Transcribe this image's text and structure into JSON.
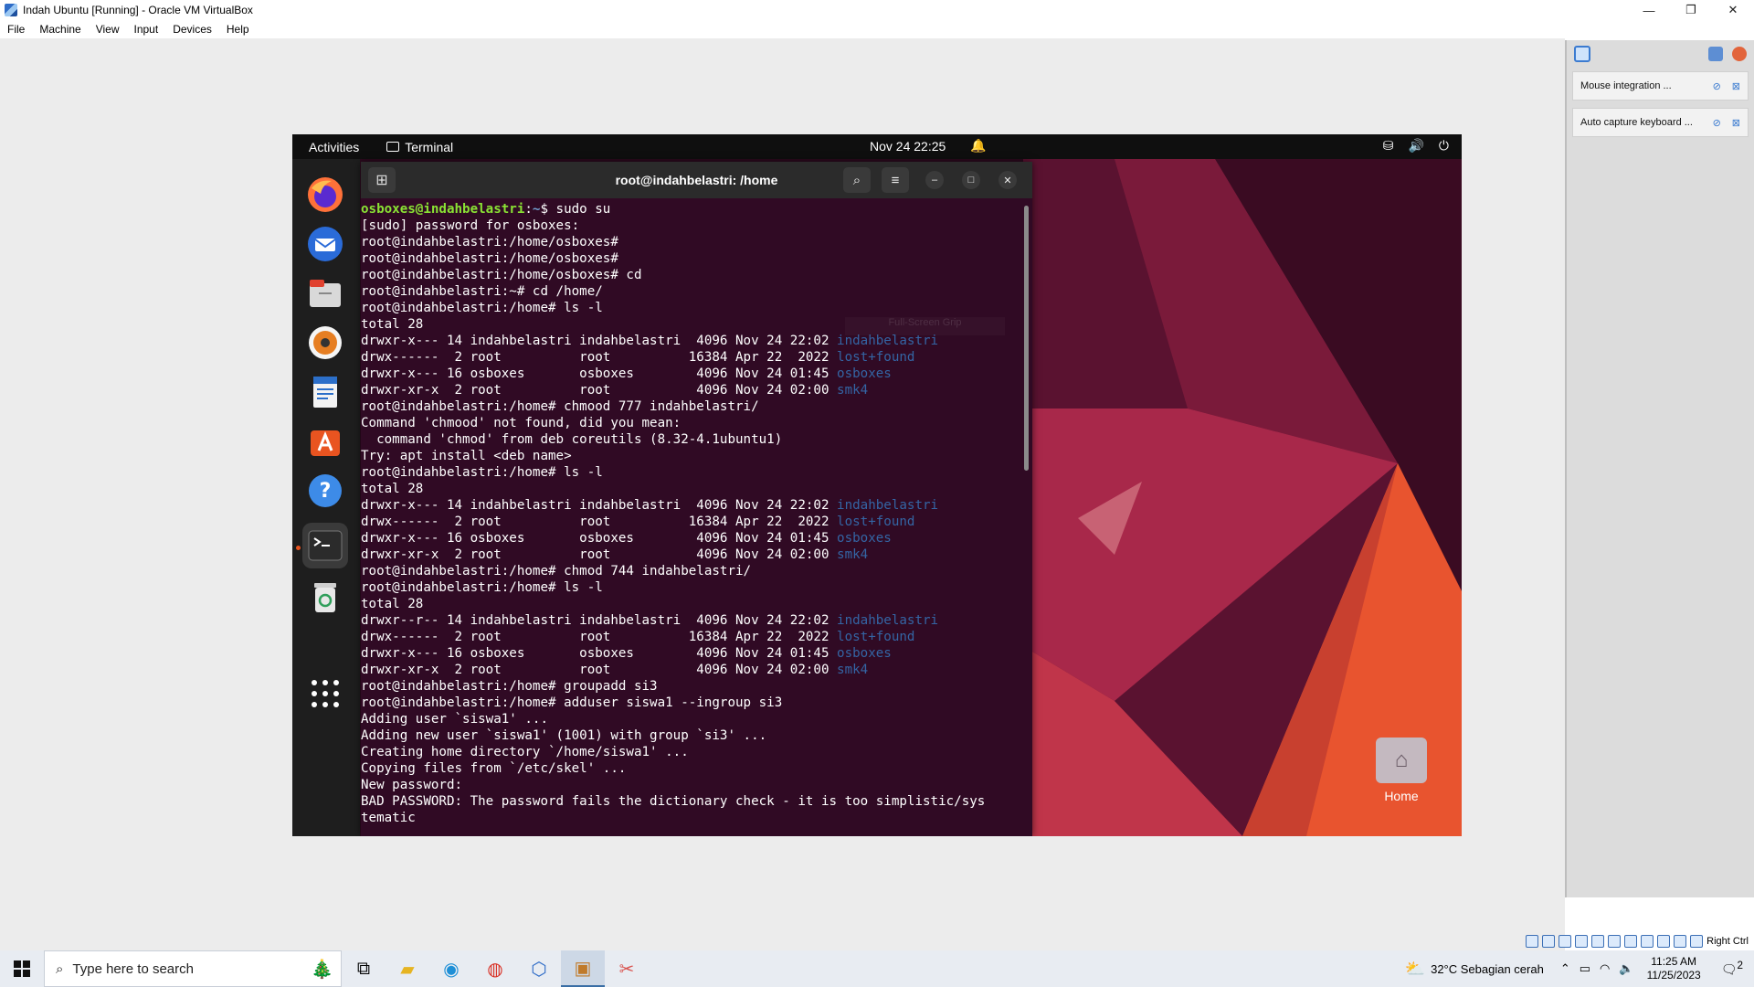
{
  "vbox": {
    "title": "Indah Ubuntu [Running] - Oracle VM VirtualBox",
    "menu": [
      "File",
      "Machine",
      "View",
      "Input",
      "Devices",
      "Help"
    ],
    "notifications": [
      {
        "text": "Mouse integration ..."
      },
      {
        "text": "Auto capture keyboard ..."
      }
    ],
    "host_key": "Right Ctrl"
  },
  "ubuntu": {
    "topbar": {
      "activities": "Activities",
      "app": "Terminal",
      "clock": "Nov 24  22:25"
    },
    "dock": [
      "firefox-icon",
      "thunderbird-icon",
      "files-icon",
      "rhythmbox-icon",
      "writer-icon",
      "app-center-icon",
      "help-icon",
      "terminal-icon",
      "trash-icon",
      "show-apps-icon"
    ],
    "terminal": {
      "title": "root@indahbelastri: /home",
      "ghost_tooltip": "Full-Screen Grip",
      "lines": [
        {
          "segments": [
            {
              "t": "osboxes@indahbelastri",
              "c": "u-green"
            },
            {
              "t": ":",
              "c": ""
            },
            {
              "t": "~",
              "c": "u-blue"
            },
            {
              "t": "$ sudo su",
              "c": ""
            }
          ]
        },
        {
          "segments": [
            {
              "t": "[sudo] password for osboxes:",
              "c": ""
            }
          ]
        },
        {
          "segments": [
            {
              "t": "root@indahbelastri:/home/osboxes#",
              "c": ""
            }
          ]
        },
        {
          "segments": [
            {
              "t": "root@indahbelastri:/home/osboxes#",
              "c": ""
            }
          ]
        },
        {
          "segments": [
            {
              "t": "root@indahbelastri:/home/osboxes# cd",
              "c": ""
            }
          ]
        },
        {
          "segments": [
            {
              "t": "root@indahbelastri:~# cd /home/",
              "c": ""
            }
          ]
        },
        {
          "segments": [
            {
              "t": "root@indahbelastri:/home# ls -l",
              "c": ""
            }
          ]
        },
        {
          "segments": [
            {
              "t": "total 28",
              "c": ""
            }
          ]
        },
        {
          "segments": [
            {
              "t": "drwxr-x--- 14 indahbelastri indahbelastri  4096 Nov 24 22:02 ",
              "c": ""
            },
            {
              "t": "indahbelastri",
              "c": "u-dir"
            }
          ]
        },
        {
          "segments": [
            {
              "t": "drwx------  2 root          root          16384 Apr 22  2022 ",
              "c": ""
            },
            {
              "t": "lost+found",
              "c": "u-dir"
            }
          ]
        },
        {
          "segments": [
            {
              "t": "drwxr-x--- 16 osboxes       osboxes        4096 Nov 24 01:45 ",
              "c": ""
            },
            {
              "t": "osboxes",
              "c": "u-dir"
            }
          ]
        },
        {
          "segments": [
            {
              "t": "drwxr-xr-x  2 root          root           4096 Nov 24 02:00 ",
              "c": ""
            },
            {
              "t": "smk4",
              "c": "u-dir"
            }
          ]
        },
        {
          "segments": [
            {
              "t": "root@indahbelastri:/home# chmood 777 indahbelastri/",
              "c": ""
            }
          ]
        },
        {
          "segments": [
            {
              "t": "Command 'chmood' not found, did you mean:",
              "c": ""
            }
          ]
        },
        {
          "segments": [
            {
              "t": "  command 'chmod' from deb coreutils (8.32-4.1ubuntu1)",
              "c": ""
            }
          ]
        },
        {
          "segments": [
            {
              "t": "Try: apt install <deb name>",
              "c": ""
            }
          ]
        },
        {
          "segments": [
            {
              "t": "root@indahbelastri:/home# ls -l",
              "c": ""
            }
          ]
        },
        {
          "segments": [
            {
              "t": "total 28",
              "c": ""
            }
          ]
        },
        {
          "segments": [
            {
              "t": "drwxr-x--- 14 indahbelastri indahbelastri  4096 Nov 24 22:02 ",
              "c": ""
            },
            {
              "t": "indahbelastri",
              "c": "u-dir"
            }
          ]
        },
        {
          "segments": [
            {
              "t": "drwx------  2 root          root          16384 Apr 22  2022 ",
              "c": ""
            },
            {
              "t": "lost+found",
              "c": "u-dir"
            }
          ]
        },
        {
          "segments": [
            {
              "t": "drwxr-x--- 16 osboxes       osboxes        4096 Nov 24 01:45 ",
              "c": ""
            },
            {
              "t": "osboxes",
              "c": "u-dir"
            }
          ]
        },
        {
          "segments": [
            {
              "t": "drwxr-xr-x  2 root          root           4096 Nov 24 02:00 ",
              "c": ""
            },
            {
              "t": "smk4",
              "c": "u-dir"
            }
          ]
        },
        {
          "segments": [
            {
              "t": "root@indahbelastri:/home# chmod 744 indahbelastri/",
              "c": ""
            }
          ]
        },
        {
          "segments": [
            {
              "t": "root@indahbelastri:/home# ls -l",
              "c": ""
            }
          ]
        },
        {
          "segments": [
            {
              "t": "total 28",
              "c": ""
            }
          ]
        },
        {
          "segments": [
            {
              "t": "drwxr--r-- 14 indahbelastri indahbelastri  4096 Nov 24 22:02 ",
              "c": ""
            },
            {
              "t": "indahbelastri",
              "c": "u-dir"
            }
          ]
        },
        {
          "segments": [
            {
              "t": "drwx------  2 root          root          16384 Apr 22  2022 ",
              "c": ""
            },
            {
              "t": "lost+found",
              "c": "u-dir"
            }
          ]
        },
        {
          "segments": [
            {
              "t": "drwxr-x--- 16 osboxes       osboxes        4096 Nov 24 01:45 ",
              "c": ""
            },
            {
              "t": "osboxes",
              "c": "u-dir"
            }
          ]
        },
        {
          "segments": [
            {
              "t": "drwxr-xr-x  2 root          root           4096 Nov 24 02:00 ",
              "c": ""
            },
            {
              "t": "smk4",
              "c": "u-dir"
            }
          ]
        },
        {
          "segments": [
            {
              "t": "root@indahbelastri:/home# groupadd si3",
              "c": ""
            }
          ]
        },
        {
          "segments": [
            {
              "t": "root@indahbelastri:/home# adduser siswa1 --ingroup si3",
              "c": ""
            }
          ]
        },
        {
          "segments": [
            {
              "t": "Adding user `siswa1' ...",
              "c": ""
            }
          ]
        },
        {
          "segments": [
            {
              "t": "Adding new user `siswa1' (1001) with group `si3' ...",
              "c": ""
            }
          ]
        },
        {
          "segments": [
            {
              "t": "Creating home directory `/home/siswa1' ...",
              "c": ""
            }
          ]
        },
        {
          "segments": [
            {
              "t": "Copying files from `/etc/skel' ...",
              "c": ""
            }
          ]
        },
        {
          "segments": [
            {
              "t": "New password:",
              "c": ""
            }
          ]
        },
        {
          "segments": [
            {
              "t": "BAD PASSWORD: The password fails the dictionary check - it is too simplistic/sys",
              "c": ""
            }
          ]
        },
        {
          "segments": [
            {
              "t": "tematic",
              "c": ""
            }
          ]
        }
      ]
    },
    "desktop": {
      "home_label": "Home"
    }
  },
  "taskbar": {
    "search_placeholder": "Type here to search",
    "weather": "32°C  Sebagian cerah",
    "time": "11:25 AM",
    "date": "11/25/2023",
    "notifications_count": "2"
  },
  "colors": {
    "terminal_bg": "#300a24",
    "prompt_green": "#8ae234",
    "dir_blue": "#3465a4",
    "ubuntu_orange": "#e95420"
  }
}
